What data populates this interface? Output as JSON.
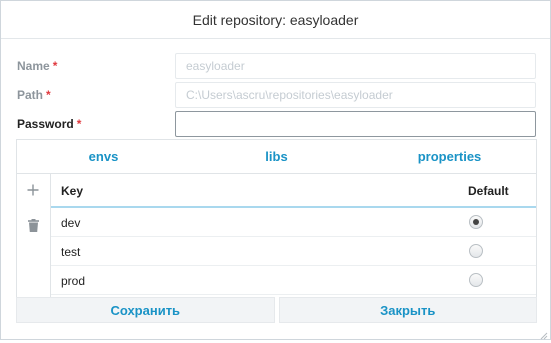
{
  "dialog": {
    "title": "Edit repository: easyloader"
  },
  "form": {
    "name": {
      "label": "Name",
      "required_mark": "*",
      "value": "easyloader"
    },
    "path": {
      "label": "Path",
      "required_mark": "*",
      "value": "C:\\Users\\ascru\\repositories\\easyloader"
    },
    "password": {
      "label": "Password",
      "required_mark": "*",
      "value": ""
    }
  },
  "tabs": [
    {
      "label": "envs"
    },
    {
      "label": "libs"
    },
    {
      "label": "properties"
    }
  ],
  "toolbar": {
    "add_icon": "plus-icon",
    "delete_icon": "trash-icon"
  },
  "grid": {
    "columns": {
      "key": "Key",
      "default": "Default"
    },
    "rows": [
      {
        "key": "dev",
        "default": true
      },
      {
        "key": "test",
        "default": false
      },
      {
        "key": "prod",
        "default": false
      }
    ]
  },
  "footer": {
    "save_label": "Сохранить",
    "close_label": "Закрыть"
  },
  "colors": {
    "accent": "#1a93c6",
    "required": "#e0393e",
    "header_underline": "#a9d8ee"
  }
}
